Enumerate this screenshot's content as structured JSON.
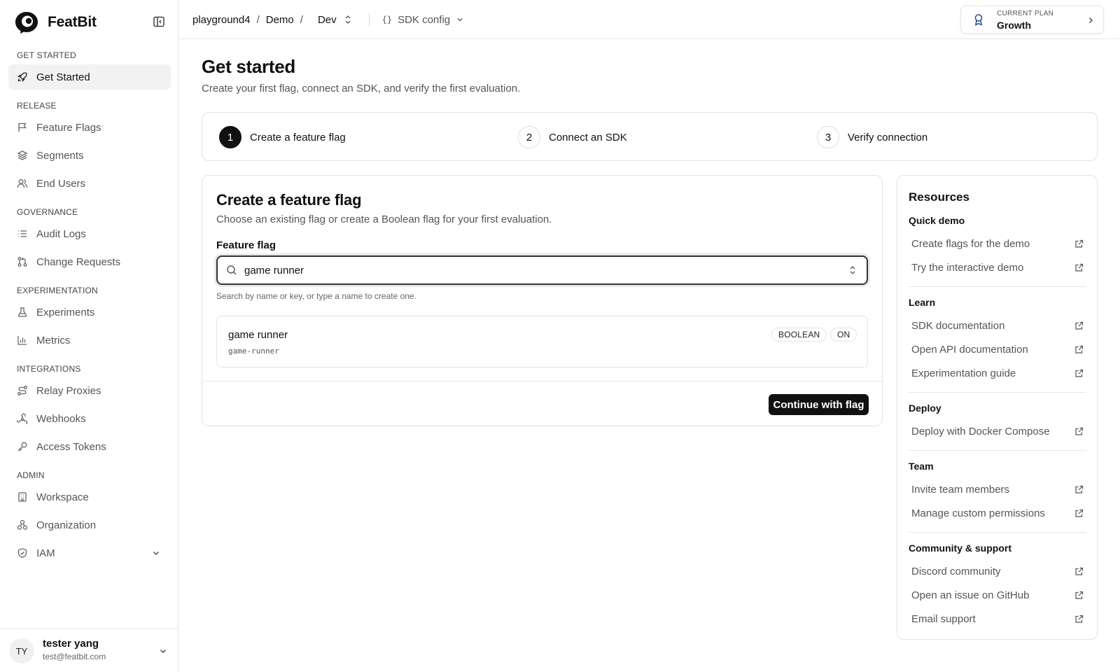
{
  "brand": {
    "name": "FeatBit"
  },
  "sidebar": {
    "sections": [
      {
        "title": "GET STARTED",
        "items": [
          {
            "label": "Get Started",
            "icon": "rocket-icon",
            "active": true
          }
        ]
      },
      {
        "title": "RELEASE",
        "items": [
          {
            "label": "Feature Flags",
            "icon": "flag-icon"
          },
          {
            "label": "Segments",
            "icon": "layers-icon"
          },
          {
            "label": "End Users",
            "icon": "users-icon"
          }
        ]
      },
      {
        "title": "GOVERNANCE",
        "items": [
          {
            "label": "Audit Logs",
            "icon": "list-icon"
          },
          {
            "label": "Change Requests",
            "icon": "git-pull-request-icon"
          }
        ]
      },
      {
        "title": "EXPERIMENTATION",
        "items": [
          {
            "label": "Experiments",
            "icon": "flask-icon"
          },
          {
            "label": "Metrics",
            "icon": "bar-chart-icon"
          }
        ]
      },
      {
        "title": "INTEGRATIONS",
        "items": [
          {
            "label": "Relay Proxies",
            "icon": "route-icon"
          },
          {
            "label": "Webhooks",
            "icon": "webhook-icon"
          },
          {
            "label": "Access Tokens",
            "icon": "key-icon"
          }
        ]
      },
      {
        "title": "ADMIN",
        "items": [
          {
            "label": "Workspace",
            "icon": "building-icon"
          },
          {
            "label": "Organization",
            "icon": "organization-icon"
          },
          {
            "label": "IAM",
            "icon": "shield-icon"
          }
        ]
      }
    ],
    "user": {
      "initials": "TY",
      "name": "tester yang",
      "email": "test@featbit.com"
    }
  },
  "topbar": {
    "crumbs": [
      "playground4",
      "Demo"
    ],
    "environment": "Dev",
    "sdk_config": "SDK config",
    "plan_label": "CURRENT PLAN",
    "plan_value": "Growth"
  },
  "page": {
    "title": "Get started",
    "subtitle": "Create your first flag, connect an SDK, and verify the first evaluation."
  },
  "steps": [
    {
      "num": "1",
      "label": "Create a feature flag"
    },
    {
      "num": "2",
      "label": "Connect an SDK"
    },
    {
      "num": "3",
      "label": "Verify connection"
    }
  ],
  "flag_card": {
    "title": "Create a feature flag",
    "subtitle": "Choose an existing flag or create a Boolean flag for your first evaluation.",
    "field_label": "Feature flag",
    "search_value": "game runner",
    "hint": "Search by name or key, or type a name to create one.",
    "result": {
      "name": "game runner",
      "key": "game-runner",
      "type_badge": "BOOLEAN",
      "status_badge": "ON"
    },
    "continue_label": "Continue with flag"
  },
  "resources": {
    "title": "Resources",
    "groups": [
      {
        "title": "Quick demo",
        "links": [
          "Create flags for the demo",
          "Try the interactive demo"
        ]
      },
      {
        "title": "Learn",
        "links": [
          "SDK documentation",
          "Open API documentation",
          "Experimentation guide"
        ]
      },
      {
        "title": "Deploy",
        "links": [
          "Deploy with Docker Compose"
        ]
      },
      {
        "title": "Team",
        "links": [
          "Invite team members",
          "Manage custom permissions"
        ]
      },
      {
        "title": "Community & support",
        "links": [
          "Discord community",
          "Open an issue on GitHub",
          "Email support"
        ]
      }
    ]
  }
}
